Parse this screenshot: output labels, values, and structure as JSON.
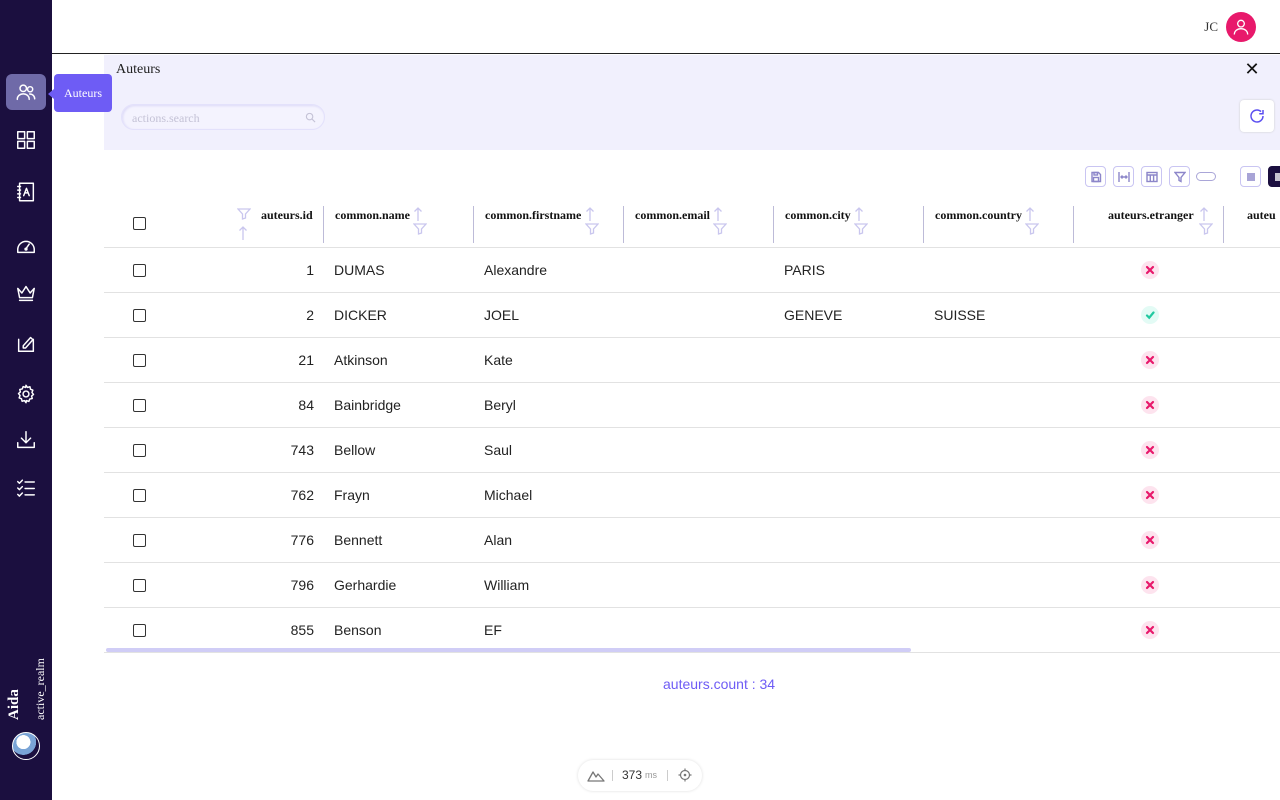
{
  "sidebar": {
    "items": [
      {
        "name": "authors",
        "icon": "users-icon",
        "tooltip": "Auteurs"
      },
      {
        "name": "dashboard",
        "icon": "grid-icon"
      },
      {
        "name": "contacts",
        "icon": "address-book-icon"
      },
      {
        "name": "speed",
        "icon": "gauge-icon"
      },
      {
        "name": "premium",
        "icon": "crown-icon"
      },
      {
        "name": "tasks",
        "icon": "clipboard-edit-icon"
      },
      {
        "name": "settings",
        "icon": "gear-icon"
      },
      {
        "name": "download",
        "icon": "download-icon"
      },
      {
        "name": "checklist",
        "icon": "checklist-icon"
      }
    ],
    "brand": "Aida",
    "realm": "active_realm"
  },
  "header": {
    "user_initials": "JC",
    "avatar_color": "#e8196b"
  },
  "panel": {
    "title": "Auteurs",
    "search_placeholder": "actions.search"
  },
  "table": {
    "columns": [
      "auteurs.id",
      "common.name",
      "common.firstname",
      "common.email",
      "common.city",
      "common.country",
      "auteurs.etranger",
      "auteu"
    ],
    "rows": [
      {
        "id": "1",
        "name": "DUMAS",
        "firstname": "Alexandre",
        "email": "",
        "city": "PARIS",
        "country": "",
        "etranger": false
      },
      {
        "id": "2",
        "name": "DICKER",
        "firstname": "JOEL",
        "email": "",
        "city": "GENEVE",
        "country": "SUISSE",
        "etranger": true
      },
      {
        "id": "21",
        "name": "Atkinson",
        "firstname": "Kate",
        "email": "",
        "city": "",
        "country": "",
        "etranger": false
      },
      {
        "id": "84",
        "name": "Bainbridge",
        "firstname": "Beryl",
        "email": "",
        "city": "",
        "country": "",
        "etranger": false
      },
      {
        "id": "743",
        "name": "Bellow",
        "firstname": "Saul",
        "email": "",
        "city": "",
        "country": "",
        "etranger": false
      },
      {
        "id": "762",
        "name": "Frayn",
        "firstname": "Michael",
        "email": "",
        "city": "",
        "country": "",
        "etranger": false
      },
      {
        "id": "776",
        "name": "Bennett",
        "firstname": "Alan",
        "email": "",
        "city": "",
        "country": "",
        "etranger": false
      },
      {
        "id": "796",
        "name": "Gerhardie",
        "firstname": "William",
        "email": "",
        "city": "",
        "country": "",
        "etranger": false
      },
      {
        "id": "855",
        "name": "Benson",
        "firstname": "EF",
        "email": "",
        "city": "",
        "country": "",
        "etranger": false
      }
    ]
  },
  "footer": {
    "count": "auteurs.count : 34",
    "perf_value": "373",
    "perf_unit": "ms"
  },
  "colors": {
    "sidebar": "#1b0f3f",
    "accent": "#6e5cf5",
    "danger": "#e8196b",
    "success": "#22c9a0"
  }
}
